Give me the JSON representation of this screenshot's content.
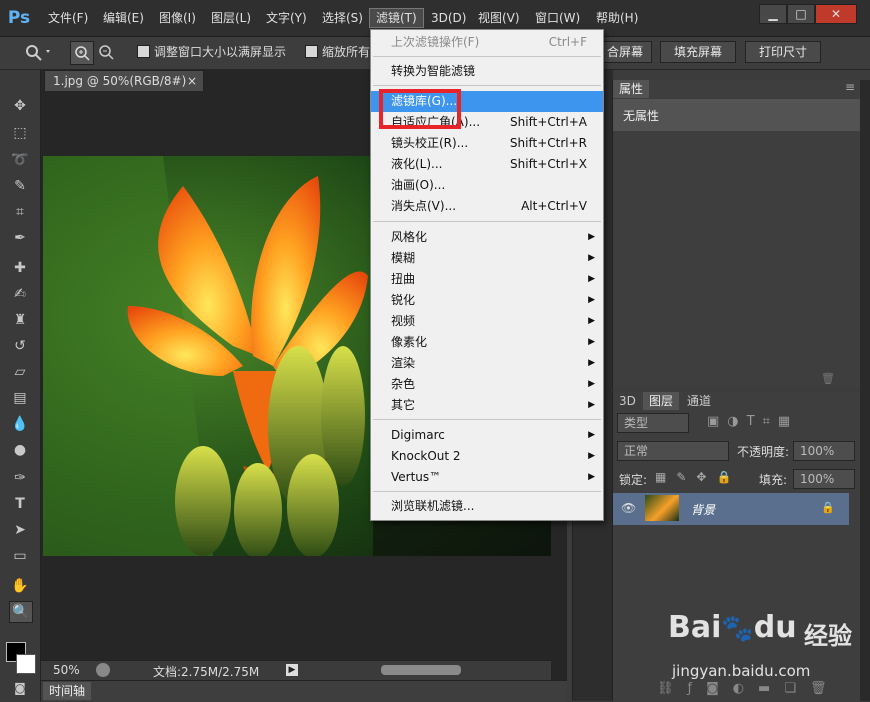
{
  "app": {
    "logo": "Ps"
  },
  "menubar": {
    "items": [
      "文件(F)",
      "编辑(E)",
      "图像(I)",
      "图层(L)",
      "文字(Y)",
      "选择(S)",
      "滤镜(T)",
      "3D(D)",
      "视图(V)",
      "窗口(W)",
      "帮助(H)"
    ],
    "active_index": 6
  },
  "window_controls": {
    "minimize": "▁",
    "maximize": "□",
    "close": "✕"
  },
  "options": {
    "zoom_icon": "magnifier-icon",
    "fit_window": "调整窗口大小以满屏显示",
    "zoom_all": "缩放所有",
    "fit_screen_btn": "合屏幕",
    "fill_screen_btn": "填充屏幕",
    "print_size_btn": "打印尺寸"
  },
  "document": {
    "tab_title": "1.jpg @ 50%(RGB/8#)",
    "close": "×",
    "zoom": "50%",
    "doc_info": "文档:2.75M/2.75M",
    "timeline_label": "时间轴"
  },
  "filter_menu": {
    "items": [
      {
        "label": "上次滤镜操作(F)",
        "shortcut": "Ctrl+F",
        "disabled": true
      },
      {
        "label": "转换为智能滤镜"
      },
      {
        "label": "滤镜库(G)...",
        "highlighted": true
      },
      {
        "label": "自适应广角(A)...",
        "shortcut": "Shift+Ctrl+A"
      },
      {
        "label": "镜头校正(R)...",
        "shortcut": "Shift+Ctrl+R"
      },
      {
        "label": "液化(L)...",
        "shortcut": "Shift+Ctrl+X"
      },
      {
        "label": "油画(O)..."
      },
      {
        "label": "消失点(V)...",
        "shortcut": "Alt+Ctrl+V"
      },
      {
        "label": "风格化",
        "submenu": true
      },
      {
        "label": "模糊",
        "submenu": true
      },
      {
        "label": "扭曲",
        "submenu": true
      },
      {
        "label": "锐化",
        "submenu": true
      },
      {
        "label": "视频",
        "submenu": true
      },
      {
        "label": "像素化",
        "submenu": true
      },
      {
        "label": "渲染",
        "submenu": true
      },
      {
        "label": "杂色",
        "submenu": true
      },
      {
        "label": "其它",
        "submenu": true
      },
      {
        "label": "Digimarc",
        "submenu": true
      },
      {
        "label": "KnockOut 2",
        "submenu": true
      },
      {
        "label": "Vertus™",
        "submenu": true
      },
      {
        "label": "浏览联机滤镜..."
      }
    ],
    "submenu_arrow": "▶"
  },
  "properties_panel": {
    "tab": "属性",
    "content": "无属性",
    "menu_icon": "≡"
  },
  "layers_panel": {
    "tabs": [
      "3D",
      "图层",
      "通道"
    ],
    "active_tab": "图层",
    "filter_kind": "类型",
    "blend_mode": "正常",
    "opacity_label": "不透明度:",
    "opacity_value": "100%",
    "lock_label": "锁定:",
    "fill_label": "填充:",
    "fill_value": "100%",
    "layer_name": "背景"
  },
  "watermark": {
    "brand": "Bai",
    "brand2": "du",
    "cn": "经验",
    "url": "jingyan.baidu.com"
  },
  "colors": {
    "highlight": "#3d95ee",
    "annotation_box": "#e8242a",
    "app_bg": "#3c3c3c"
  }
}
